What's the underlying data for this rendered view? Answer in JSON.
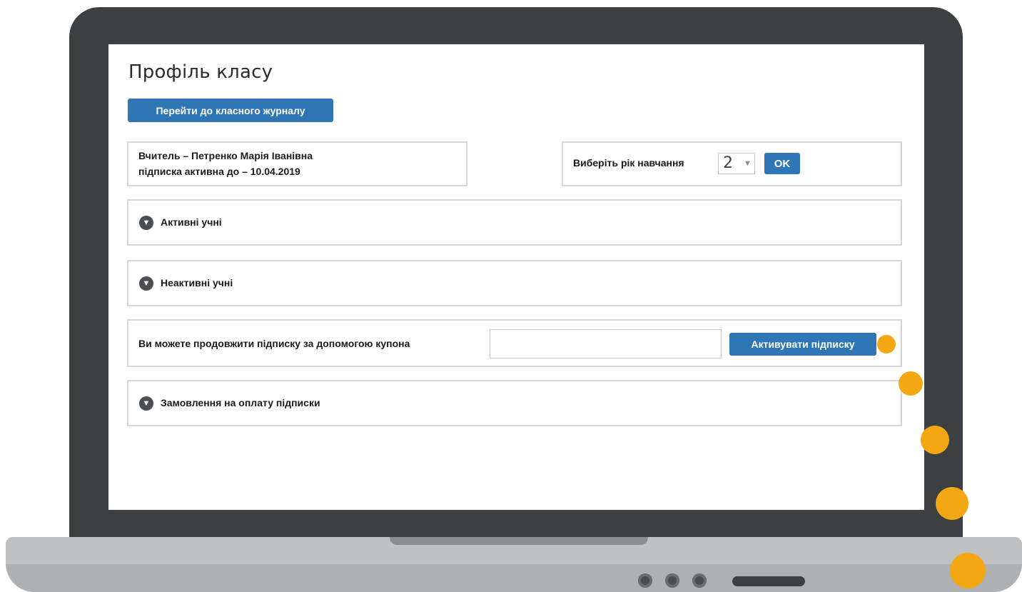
{
  "page": {
    "title": "Профіль класу",
    "journal_button": "Перейти до класного журналу"
  },
  "teacher": {
    "line1": "Вчитель – Петренко Марія Іванівна",
    "line2": "підписка активна до – 10.04.2019"
  },
  "year_picker": {
    "label": "Виберіть рік навчання",
    "selected": "2",
    "arrow": "▼",
    "ok_button": "OK"
  },
  "sections": {
    "active_students": "Активні учні",
    "inactive_students": "Неактивні учні",
    "orders": "Замовлення на оплату підписки"
  },
  "coupon": {
    "label": "Ви можете продовжити підписку за допомогою купона",
    "value": "",
    "activate_button": "Активувати підписку"
  },
  "icons": {
    "chevron": "chevron-down-icon"
  },
  "colors": {
    "accent": "#2f76b6",
    "dots": "#f3a712",
    "laptop_frame": "#3d4042"
  }
}
